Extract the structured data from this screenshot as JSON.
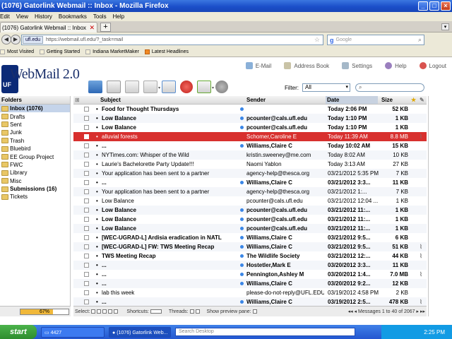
{
  "window": {
    "title": "(1076) Gatorlink Webmail :: Inbox - Mozilla Firefox"
  },
  "menu": [
    "Edit",
    "View",
    "History",
    "Bookmarks",
    "Tools",
    "Help"
  ],
  "tab": {
    "label": "(1076) Gatorlink Webmail :: Inbox",
    "new_tab": "+"
  },
  "nav": {
    "domain": "ufl.edu",
    "url": "https://webmail.ufl.edu/?_task=mail",
    "search_placeholder": "Google"
  },
  "bookmarks": [
    "Most Visited",
    "Getting Started",
    "Indiana MarketMaker",
    "Latest Headlines"
  ],
  "webmail": {
    "logo_text": "WebMail 2.0",
    "logo_badge": "UF",
    "links": [
      "E-Mail",
      "Address Book",
      "Settings",
      "Help",
      "Logout"
    ],
    "filter_label": "Filter:",
    "filter_value": "All",
    "quicksearch_icon": "⌕"
  },
  "folders": {
    "header": "Folders",
    "items": [
      "Inbox (1076)",
      "Drafts",
      "Sent",
      "Junk",
      "Trash",
      "Bluebird",
      "EE Group Project",
      "FWC",
      "Library",
      "Misc",
      "Submissions (16)",
      "Tickets"
    ],
    "quota": "67%",
    "quota_fraction": 0.67
  },
  "list": {
    "columns": {
      "subject": "Subject",
      "sender": "Sender",
      "date": "Date",
      "size": "Size"
    },
    "rows": [
      {
        "subject": "Food for Thought Thursdays",
        "sender": "",
        "date": "Today 2:06 PM",
        "size": "52 KB",
        "unread": true,
        "dot": true
      },
      {
        "subject": "Low Balance",
        "sender": "pcounter@cals.ufl.edu",
        "date": "Today 1:10 PM",
        "size": "1 KB",
        "unread": true,
        "dot": true
      },
      {
        "subject": "Low Balance",
        "sender": "pcounter@cals.ufl.edu",
        "date": "Today 1:10 PM",
        "size": "1 KB",
        "unread": true,
        "dot": true
      },
      {
        "subject": "alluvial forests",
        "sender": "Schomer,Caroline E",
        "date": "Today 11:39 AM",
        "size": "8.8 MB",
        "selected": true,
        "clip": true
      },
      {
        "subject": "...",
        "sender": "Williams,Claire C",
        "date": "Today 10:02 AM",
        "size": "15 KB",
        "unread": true,
        "dot": true
      },
      {
        "subject": "NYTimes.com: Whisper of the Wild",
        "sender": "kristin.sweeney@me.com",
        "date": "Today 8:02 AM",
        "size": "10 KB"
      },
      {
        "subject": "Laurie's Bachelorette Party Update!!!",
        "sender": "Naomi Yablon",
        "date": "Today 3:13 AM",
        "size": "27 KB"
      },
      {
        "subject": "Your application has been sent to a partner",
        "sender": "agency-help@thesca.org",
        "date": "03/21/2012 5:35 PM",
        "size": "7 KB"
      },
      {
        "subject": "...",
        "sender": "Williams,Claire C",
        "date": "03/21/2012 3:3...",
        "size": "11 KB",
        "unread": true,
        "dot": true
      },
      {
        "subject": "Your application has been sent to a partner",
        "sender": "agency-help@thesca.org",
        "date": "03/21/2012 1:...",
        "size": "7 KB"
      },
      {
        "subject": "Low Balance",
        "sender": "pcounter@cals.ufl.edu",
        "date": "03/21/2012 12:04 ...",
        "size": "1 KB"
      },
      {
        "subject": "Low Balance",
        "sender": "pcounter@cals.ufl.edu",
        "date": "03/21/2012 11:...",
        "size": "1 KB",
        "unread": true,
        "dot": true
      },
      {
        "subject": "Low Balance",
        "sender": "pcounter@cals.ufl.edu",
        "date": "03/21/2012 11:...",
        "size": "1 KB",
        "unread": true,
        "dot": true
      },
      {
        "subject": "Low Balance",
        "sender": "pcounter@cals.ufl.edu",
        "date": "03/21/2012 11:...",
        "size": "1 KB",
        "unread": true,
        "dot": true
      },
      {
        "subject": "[WEC-UGRAD-L] Ardisia eradication in NATL",
        "sender": "Williams,Claire C",
        "date": "03/21/2012 9:5...",
        "size": "6 KB",
        "unread": true,
        "dot": true
      },
      {
        "subject": "[WEC-UGRAD-L] FW: TWS Meeting Recap",
        "sender": "Williams,Claire C",
        "date": "03/21/2012 9:5...",
        "size": "51 KB",
        "unread": true,
        "dot": true,
        "clip": true
      },
      {
        "subject": "TWS Meeting Recap",
        "sender": "The Wildlife Society",
        "date": "03/21/2012 12:...",
        "size": "44 KB",
        "unread": true,
        "dot": true,
        "clip": true
      },
      {
        "subject": "...",
        "sender": "Hostetler,Mark E",
        "date": "03/20/2012 3:3...",
        "size": "11 KB",
        "unread": true,
        "dot": true
      },
      {
        "subject": "...",
        "sender": "Pennington,Ashley M",
        "date": "03/20/2012 1:4...",
        "size": "7.0 MB",
        "unread": true,
        "dot": true,
        "clip": true
      },
      {
        "subject": "...",
        "sender": "Williams,Claire C",
        "date": "03/20/2012 9:2...",
        "size": "12 KB",
        "unread": true,
        "dot": true
      },
      {
        "subject": "lab this week",
        "sender": "please-do-not-reply@UFL.EDU",
        "date": "03/19/2012 4:58 PM",
        "size": "2 KB"
      },
      {
        "subject": "...",
        "sender": "Williams,Claire C",
        "date": "03/19/2012 2:5...",
        "size": "478 KB",
        "unread": true,
        "dot": true,
        "clip": true
      }
    ],
    "footer": {
      "select": "Select:",
      "shortcuts": "Shortcuts:",
      "threads": "Threads:",
      "preview": "Show preview pane:",
      "paging": "Messages 1 to 40 of 2067"
    }
  },
  "taskbar": {
    "start": "start",
    "tasks": [
      "4427",
      "(1076) Gatorlink Web..."
    ],
    "search_placeholder": "Search Desktop",
    "clock": "2:25 PM"
  },
  "colors": {
    "selected_row": "#d8302e",
    "unread_dot": "#3a86e6",
    "quota_fill": "#f0b83a"
  }
}
